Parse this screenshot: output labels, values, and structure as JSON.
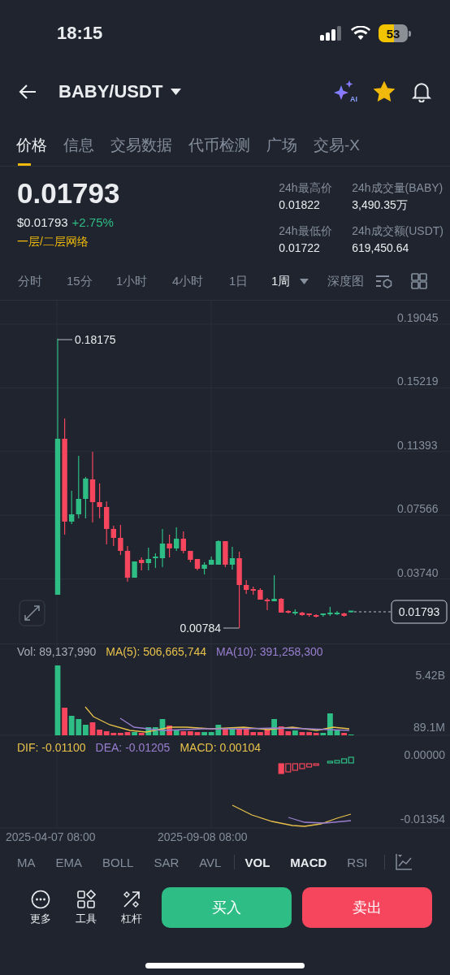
{
  "status_bar": {
    "time": "18:15",
    "battery": "53"
  },
  "header": {
    "pair": "BABY/USDT",
    "ai_badge": "AI",
    "favorite": true
  },
  "tabs": [
    {
      "label": "价格",
      "selected": true
    },
    {
      "label": "信息",
      "selected": false
    },
    {
      "label": "交易数据",
      "selected": false
    },
    {
      "label": "代币检测",
      "selected": false
    },
    {
      "label": "广场",
      "selected": false
    },
    {
      "label": "交易-X",
      "selected": false
    }
  ],
  "price": {
    "last": "0.01793",
    "fiat": "$0.01793",
    "change": "+2.75%",
    "tag": "一层/二层网络"
  },
  "stats": [
    {
      "label": "24h最高价",
      "value": "0.01822"
    },
    {
      "label": "24h成交量(BABY)",
      "value": "3,490.35万"
    },
    {
      "label": "24h最低价",
      "value": "0.01722"
    },
    {
      "label": "24h成交额(USDT)",
      "value": "619,450.64"
    }
  ],
  "intervals": [
    {
      "label": "分时",
      "selected": false
    },
    {
      "label": "15分",
      "selected": false
    },
    {
      "label": "1小时",
      "selected": false
    },
    {
      "label": "4小时",
      "selected": false
    },
    {
      "label": "1日",
      "selected": false
    },
    {
      "label": "1周",
      "selected": true
    }
  ],
  "depth_label": "深度图",
  "chart": {
    "chart_data": {
      "type": "candlestick",
      "grid": true,
      "ylim": [
        -0.00133,
        0.2046
      ],
      "ohlc": [
        [
          0.02795,
          0.18175,
          0.02795,
          0.12164
        ],
        [
          0.12164,
          0.13384,
          0.06406,
          0.07187
        ],
        [
          0.07187,
          0.09041,
          0.0704,
          0.07626
        ],
        [
          0.07626,
          0.11139,
          0.07382,
          0.08553
        ],
        [
          0.08553,
          0.09871,
          0.07382,
          0.09773
        ],
        [
          0.09724,
          0.11383,
          0.07138,
          0.08358
        ],
        [
          0.08358,
          0.0948,
          0.07382,
          0.08065
        ],
        [
          0.08065,
          0.08407,
          0.0582,
          0.06747
        ],
        [
          0.06747,
          0.06943,
          0.05723,
          0.06211
        ],
        [
          0.06211,
          0.06991,
          0.05186,
          0.0543
        ],
        [
          0.0543,
          0.05723,
          0.03575,
          0.03819
        ],
        [
          0.03819,
          0.04795,
          0.03819,
          0.04795
        ],
        [
          0.04893,
          0.05039,
          0.04259,
          0.04698
        ],
        [
          0.04698,
          0.05625,
          0.04259,
          0.04942
        ],
        [
          0.04942,
          0.05283,
          0.04405,
          0.05039
        ],
        [
          0.04991,
          0.06747,
          0.04454,
          0.05869
        ],
        [
          0.05869,
          0.06406,
          0.05039,
          0.05576
        ],
        [
          0.05576,
          0.06845,
          0.0543,
          0.06162
        ],
        [
          0.06162,
          0.06601,
          0.05283,
          0.0543
        ],
        [
          0.0543,
          0.0543,
          0.04747,
          0.04893
        ],
        [
          0.04942,
          0.04942,
          0.04259,
          0.04356
        ],
        [
          0.04356,
          0.04747,
          0.04015,
          0.046
        ],
        [
          0.046,
          0.05088,
          0.046,
          0.04893
        ],
        [
          0.046,
          0.06064,
          0.046,
          0.06015
        ],
        [
          0.06015,
          0.06015,
          0.04454,
          0.046
        ],
        [
          0.046,
          0.05674,
          0.04307,
          0.04991
        ],
        [
          0.04991,
          0.05381,
          0.00784,
          0.0338
        ],
        [
          0.0338,
          0.03673,
          0.02843,
          0.03087
        ],
        [
          0.03087,
          0.03283,
          0.02795,
          0.03039
        ],
        [
          0.03087,
          0.03185,
          0.02502,
          0.02502
        ],
        [
          0.02502,
          0.02599,
          0.01867,
          0.02404
        ],
        [
          0.02404,
          0.03966,
          0.02404,
          0.02551
        ],
        [
          0.02551,
          0.02599,
          0.01721,
          0.01721
        ],
        [
          0.01819,
          0.01867,
          0.01672,
          0.01721
        ],
        [
          0.01672,
          0.01916,
          0.01575,
          0.0177
        ],
        [
          0.01721,
          0.0177,
          0.01526,
          0.01575
        ],
        [
          0.01623,
          0.01672,
          0.01477,
          0.01526
        ],
        [
          0.01575,
          0.01623,
          0.01428,
          0.01477
        ],
        [
          0.01526,
          0.01672,
          0.01477,
          0.01623
        ],
        [
          0.01575,
          0.02063,
          0.01526,
          0.01672
        ],
        [
          0.01623,
          0.01819,
          0.01575,
          0.01721
        ],
        [
          0.01672,
          0.01721,
          0.01477,
          0.01526
        ],
        [
          0.01721,
          0.01793,
          0.01721,
          0.01793
        ]
      ],
      "yticks": [
        {
          "value": 0.19045,
          "label": "0.19045"
        },
        {
          "value": 0.15219,
          "label": "0.15219"
        },
        {
          "value": 0.11393,
          "label": "0.11393"
        },
        {
          "value": 0.07566,
          "label": "0.07566"
        },
        {
          "value": 0.0374,
          "label": "0.03740"
        }
      ]
    },
    "time_labels": [
      "2025-04-07 08:00",
      "2025-09-08 08:00"
    ],
    "high_label": "0.18175",
    "low_label": "0.00784",
    "last_price": "0.01793",
    "volume_legend": [
      {
        "text": "Vol: 89,137,990",
        "color": "#a7adb8"
      },
      {
        "text": "MA(5): 506,665,744",
        "color": "#e8c14b"
      },
      {
        "text": "MA(10): 391,258,300",
        "color": "#9a7fd1"
      }
    ],
    "volume_ticks": [
      "5.42B",
      "89.1M"
    ],
    "macd_legend": [
      {
        "text": "DIF: -0.01100",
        "color": "#e8c14b"
      },
      {
        "text": "DEA: -0.01205",
        "color": "#9a7fd1"
      },
      {
        "text": "MACD: 0.00104",
        "color": "#e8c14b"
      }
    ],
    "macd_ticks": [
      "0.00000",
      "-0.01354"
    ]
  },
  "main_indicators": [
    {
      "label": "MA",
      "selected": false
    },
    {
      "label": "EMA",
      "selected": false
    },
    {
      "label": "BOLL",
      "selected": false
    },
    {
      "label": "SAR",
      "selected": false
    },
    {
      "label": "AVL",
      "selected": false
    }
  ],
  "sub_indicators": [
    {
      "label": "VOL",
      "selected": true
    },
    {
      "label": "MACD",
      "selected": true
    },
    {
      "label": "RSI",
      "selected": false
    }
  ],
  "actions": [
    {
      "label": "更多",
      "kind": "more"
    },
    {
      "label": "工具",
      "kind": "tools"
    },
    {
      "label": "杠杆",
      "kind": "leverage"
    }
  ],
  "buy": "买入",
  "sell": "卖出"
}
